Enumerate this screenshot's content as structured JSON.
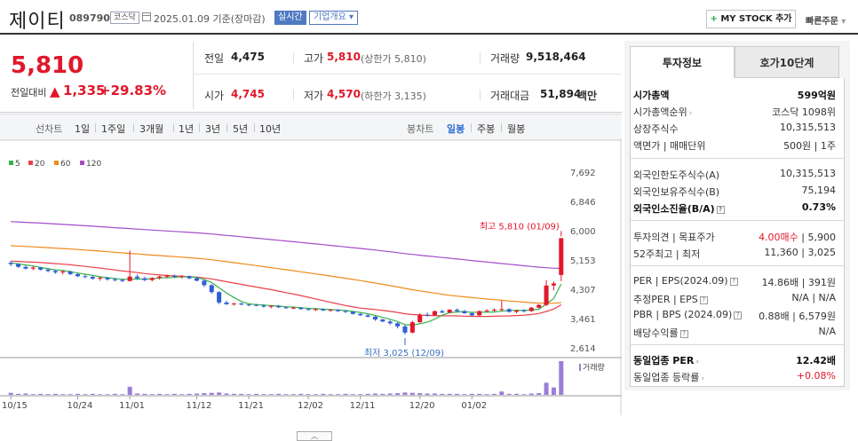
{
  "header": {
    "name": "제이티",
    "code": "089790",
    "market": "코스닥",
    "date": "2025.01.09 기준(장마감)",
    "realtime": "실시간",
    "company_overview": "기업개요",
    "my_stock": "MY STOCK 추가",
    "quick_order": "빠른주문"
  },
  "summary": {
    "price": "5,810",
    "change_label": "전일대비",
    "change_amount": "1,335",
    "change_rate": "+29.83%",
    "prev_close_label": "전일",
    "prev_close": "4,475",
    "high_label": "고가",
    "high": "5,810",
    "high_note": "(상한가 5,810)",
    "volume_label": "거래량",
    "volume": "9,518,464",
    "open_label": "시가",
    "open": "4,745",
    "low_label": "저가",
    "low": "4,570",
    "low_note": "(하한가 3,135)",
    "amount_label": "거래대금",
    "amount": "51,894",
    "amount_unit": "백만"
  },
  "chart_menu": {
    "line_chart": "선차트",
    "periods": [
      "1일",
      "1주일",
      "3개월",
      "1년",
      "3년",
      "5년",
      "10년"
    ],
    "candle_chart": "봉차트",
    "candle_periods": [
      "일봉",
      "주봉",
      "월봉"
    ]
  },
  "panel": {
    "tab_active": "투자정보",
    "tab_inactive": "호가10단계",
    "market_cap_label": "시가총액",
    "market_cap": "599억원",
    "cap_rank_label": "시가총액순위",
    "cap_rank": "코스닥 1098위",
    "shares_label": "상장주식수",
    "shares": "10,315,513",
    "par_label": "액면가 | 매매단위",
    "par": "500원 | 1주",
    "foreign_limit_label": "외국인한도주식수(A)",
    "foreign_limit": "10,315,513",
    "foreign_hold_label": "외국인보유주식수(B)",
    "foreign_hold": "75,194",
    "foreign_ratio_label": "외국인소진율(B/A)",
    "foreign_ratio": "0.73%",
    "opinion_label": "투자의견 | 목표주가",
    "opinion": "4.00매수",
    "target": "5,900",
    "w52_label": "52주최고 | 최저",
    "w52": "11,360 | 3,025",
    "per_label": "PER | EPS(2024.09)",
    "per": "14.86배 | 391원",
    "est_per_label": "추정PER | EPS",
    "est_per": "N/A | N/A",
    "pbr_label": "PBR | BPS (2024.09)",
    "pbr": "0.88배 | 6,579원",
    "div_label": "배당수익률",
    "div": "N/A",
    "sector_per_label": "동일업종 PER",
    "sector_per": "12.42배",
    "sector_rate_label": "동일업종 등락률",
    "sector_rate": "+0.08%"
  },
  "colors": {
    "up": "#e0182b",
    "down": "#2f5fd6",
    "ma5": "#36b34a",
    "ma20": "#e8404a",
    "ma60": "#f08a1c",
    "ma120": "#a24ec9"
  },
  "chart_data": {
    "type": "candlestick",
    "legend": [
      "5",
      "20",
      "60",
      "120"
    ],
    "y_ticks": [
      "7,692",
      "6,846",
      "6,000",
      "5,153",
      "4,307",
      "3,461",
      "2,614"
    ],
    "ylim": [
      2614,
      7692
    ],
    "x_ticks": [
      "10/15",
      "10/24",
      "11/01",
      "11/12",
      "11/21",
      "12/02",
      "12/11",
      "12/20",
      "01/02"
    ],
    "annotation_high": "최고 5,810 (01/09)",
    "annotation_low": "최저 3,025 (12/09)",
    "volume_label": "거래량",
    "candles": [
      [
        5100,
        5150,
        5000,
        5060
      ],
      [
        5060,
        5080,
        4950,
        4980
      ],
      [
        4980,
        5020,
        4900,
        4930
      ],
      [
        4930,
        5000,
        4880,
        4960
      ],
      [
        4960,
        4980,
        4870,
        4900
      ],
      [
        4900,
        4950,
        4820,
        4860
      ],
      [
        4860,
        4900,
        4780,
        4820
      ],
      [
        4820,
        4880,
        4760,
        4850
      ],
      [
        4850,
        4870,
        4740,
        4770
      ],
      [
        4770,
        4800,
        4680,
        4710
      ],
      [
        4710,
        4760,
        4650,
        4690
      ],
      [
        4690,
        4720,
        4600,
        4640
      ],
      [
        4640,
        4700,
        4580,
        4670
      ],
      [
        4670,
        4690,
        4580,
        4620
      ],
      [
        4620,
        4660,
        4560,
        4600
      ],
      [
        4600,
        4640,
        4540,
        4570
      ],
      [
        4570,
        5450,
        4560,
        4700
      ],
      [
        4700,
        4760,
        4600,
        4650
      ],
      [
        4650,
        4700,
        4560,
        4600
      ],
      [
        4600,
        4680,
        4560,
        4660
      ],
      [
        4660,
        4720,
        4610,
        4700
      ],
      [
        4700,
        4760,
        4650,
        4720
      ],
      [
        4720,
        4760,
        4660,
        4690
      ],
      [
        4690,
        4740,
        4640,
        4710
      ],
      [
        4710,
        4730,
        4620,
        4650
      ],
      [
        4650,
        4700,
        4560,
        4580
      ],
      [
        4580,
        4620,
        4400,
        4450
      ],
      [
        4450,
        4480,
        4200,
        4250
      ],
      [
        4250,
        4280,
        3900,
        3950
      ],
      [
        3950,
        4000,
        3880,
        3900
      ],
      [
        3900,
        3940,
        3860,
        3920
      ],
      [
        3920,
        3950,
        3870,
        3890
      ],
      [
        3890,
        3920,
        3840,
        3880
      ],
      [
        3880,
        3910,
        3840,
        3860
      ],
      [
        3860,
        3900,
        3800,
        3830
      ],
      [
        3830,
        3870,
        3780,
        3850
      ],
      [
        3850,
        3880,
        3790,
        3810
      ],
      [
        3810,
        3840,
        3770,
        3790
      ],
      [
        3790,
        3830,
        3760,
        3800
      ],
      [
        3800,
        3820,
        3740,
        3760
      ],
      [
        3760,
        3790,
        3720,
        3740
      ],
      [
        3740,
        3780,
        3700,
        3760
      ],
      [
        3760,
        3780,
        3700,
        3720
      ],
      [
        3720,
        3760,
        3680,
        3740
      ],
      [
        3740,
        3760,
        3680,
        3700
      ],
      [
        3700,
        3730,
        3650,
        3680
      ],
      [
        3680,
        3700,
        3600,
        3620
      ],
      [
        3620,
        3650,
        3560,
        3580
      ],
      [
        3580,
        3610,
        3520,
        3540
      ],
      [
        3540,
        3560,
        3420,
        3460
      ],
      [
        3460,
        3480,
        3380,
        3400
      ],
      [
        3400,
        3440,
        3300,
        3350
      ],
      [
        3350,
        3380,
        3200,
        3260
      ],
      [
        3260,
        3300,
        3025,
        3080
      ],
      [
        3080,
        3420,
        3060,
        3380
      ],
      [
        3380,
        3640,
        3360,
        3600
      ],
      [
        3600,
        3660,
        3540,
        3580
      ],
      [
        3580,
        3720,
        3560,
        3700
      ],
      [
        3700,
        3740,
        3640,
        3660
      ],
      [
        3660,
        3760,
        3640,
        3740
      ],
      [
        3740,
        3780,
        3680,
        3700
      ],
      [
        3700,
        3740,
        3620,
        3640
      ],
      [
        3640,
        3680,
        3560,
        3580
      ],
      [
        3580,
        3720,
        3560,
        3700
      ],
      [
        3700,
        3760,
        3660,
        3720
      ],
      [
        3720,
        3780,
        3680,
        3740
      ],
      [
        3740,
        4000,
        3700,
        3760
      ],
      [
        3760,
        3780,
        3660,
        3680
      ],
      [
        3680,
        3740,
        3640,
        3720
      ],
      [
        3720,
        3760,
        3660,
        3700
      ],
      [
        3700,
        3820,
        3680,
        3800
      ],
      [
        3800,
        3900,
        3780,
        3880
      ],
      [
        3880,
        4600,
        3840,
        4440
      ],
      [
        4440,
        4560,
        4300,
        4500
      ],
      [
        4745,
        5810,
        4570,
        5810
      ]
    ],
    "volumes": [
      0.6,
      0.3,
      0.4,
      0.2,
      0.3,
      0.2,
      0.3,
      0.2,
      0.2,
      0.3,
      0.2,
      0.3,
      0.2,
      0.2,
      0.3,
      0.2,
      2.4,
      0.4,
      0.3,
      0.2,
      0.3,
      0.2,
      0.3,
      0.2,
      0.3,
      0.4,
      0.5,
      0.6,
      0.7,
      0.4,
      0.3,
      0.3,
      0.2,
      0.3,
      0.2,
      0.2,
      0.3,
      0.2,
      0.2,
      0.3,
      0.2,
      0.2,
      0.3,
      0.2,
      0.2,
      0.3,
      0.2,
      0.2,
      0.3,
      0.4,
      0.3,
      0.4,
      0.5,
      0.7,
      0.6,
      0.5,
      0.4,
      0.4,
      0.3,
      0.3,
      0.3,
      0.2,
      0.3,
      0.3,
      0.2,
      0.3,
      1.0,
      0.3,
      0.3,
      0.2,
      0.4,
      0.5,
      3.6,
      2.2,
      10.0
    ]
  }
}
